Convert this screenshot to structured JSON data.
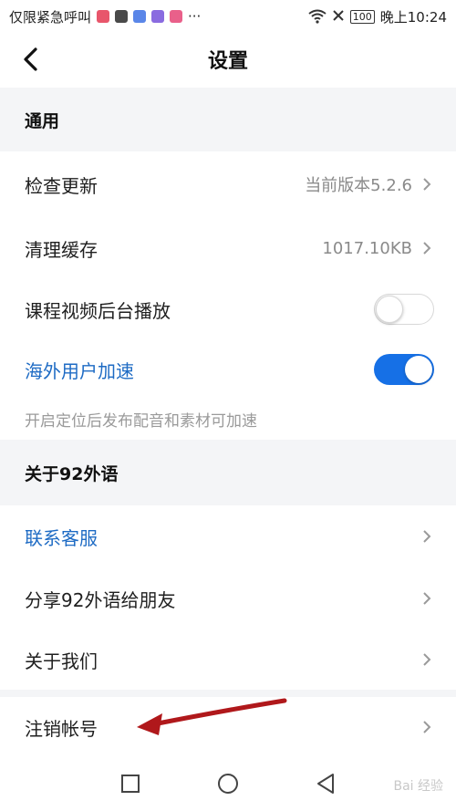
{
  "status_bar": {
    "left_text": "仅限紧急呼叫",
    "battery": "100",
    "time": "晚上10:24",
    "more": "···"
  },
  "nav": {
    "title": "设置"
  },
  "sections": {
    "general": "通用",
    "about": "关于92外语"
  },
  "rows": {
    "check_update": {
      "label": "检查更新",
      "value": "当前版本5.2.6"
    },
    "clear_cache": {
      "label": "清理缓存",
      "value": "1017.10KB"
    },
    "bg_play": {
      "label": "课程视频后台播放",
      "enabled": false
    },
    "overseas": {
      "label": "海外用户加速",
      "enabled": true
    },
    "overseas_hint": "开启定位后发布配音和素材可加速",
    "contact": {
      "label": "联系客服"
    },
    "share": {
      "label": "分享92外语给朋友"
    },
    "about_us": {
      "label": "关于我们"
    },
    "deregister": {
      "label": "注销帐号"
    }
  },
  "colors": {
    "accent": "#1670e6",
    "link": "#1e6bc4",
    "annotation_arrow": "#b0181b"
  },
  "watermark": "Bai 经验"
}
